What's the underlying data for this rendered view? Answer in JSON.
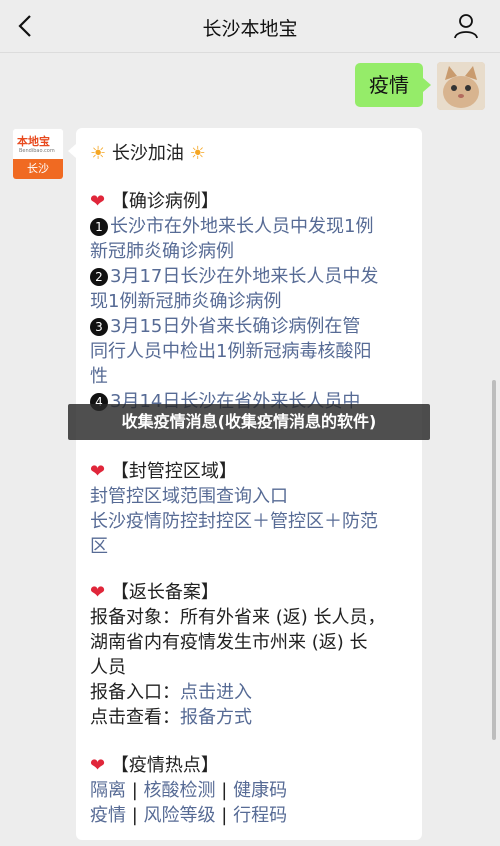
{
  "header": {
    "title": "长沙本地宝"
  },
  "chat": {
    "outgoing_text": "疫情",
    "bot_avatar_logo": "本地宝",
    "bot_avatar_site": "Bendibao.com",
    "bot_avatar_city": "长沙"
  },
  "card": {
    "greeting": "长沙加油",
    "confirmed": {
      "heading": "【确诊病例】",
      "items": [
        {
          "num": "1",
          "lines": [
            "长沙市在外地来长人员中发现1例",
            "新冠肺炎确诊病例"
          ]
        },
        {
          "num": "2",
          "lines": [
            "3月17日长沙在外地来长人员中发",
            "现1例新冠肺炎确诊病例"
          ]
        },
        {
          "num": "3",
          "lines": [
            "3月15日外省来长确诊病例在管",
            "同行人员中检出1例新冠病毒核酸阳",
            "性"
          ]
        },
        {
          "num": "4",
          "lines": [
            "3月14日长沙在省外来长人员中"
          ]
        }
      ]
    },
    "control": {
      "heading": "【封管控区域】",
      "lines": [
        "封管控区域范围查询入口",
        "长沙疫情防控封控区＋管控区＋防范",
        "区"
      ]
    },
    "report": {
      "heading": "【返长备案】",
      "text_lines": [
        "报备对象：所有外省来 (返) 长人员，",
        "湖南省内有疫情发生市州来 (返) 长",
        "人员"
      ],
      "entry_label": "报备入口：",
      "entry_link": "点击进入",
      "view_label": "点击查看：",
      "view_link": "报备方式"
    },
    "hot": {
      "heading": "【疫情热点】",
      "row1": [
        "隔离",
        "核酸检测",
        "健康码"
      ],
      "row2": [
        "疫情",
        "风险等级",
        "行程码"
      ],
      "separator": "|"
    }
  },
  "overlay": {
    "banner": "收集疫情消息(收集疫情消息的软件)"
  },
  "colors": {
    "link": "#576b95",
    "bubble": "#95ec69",
    "heart": "#e0263a",
    "brand": "#f06a22"
  }
}
